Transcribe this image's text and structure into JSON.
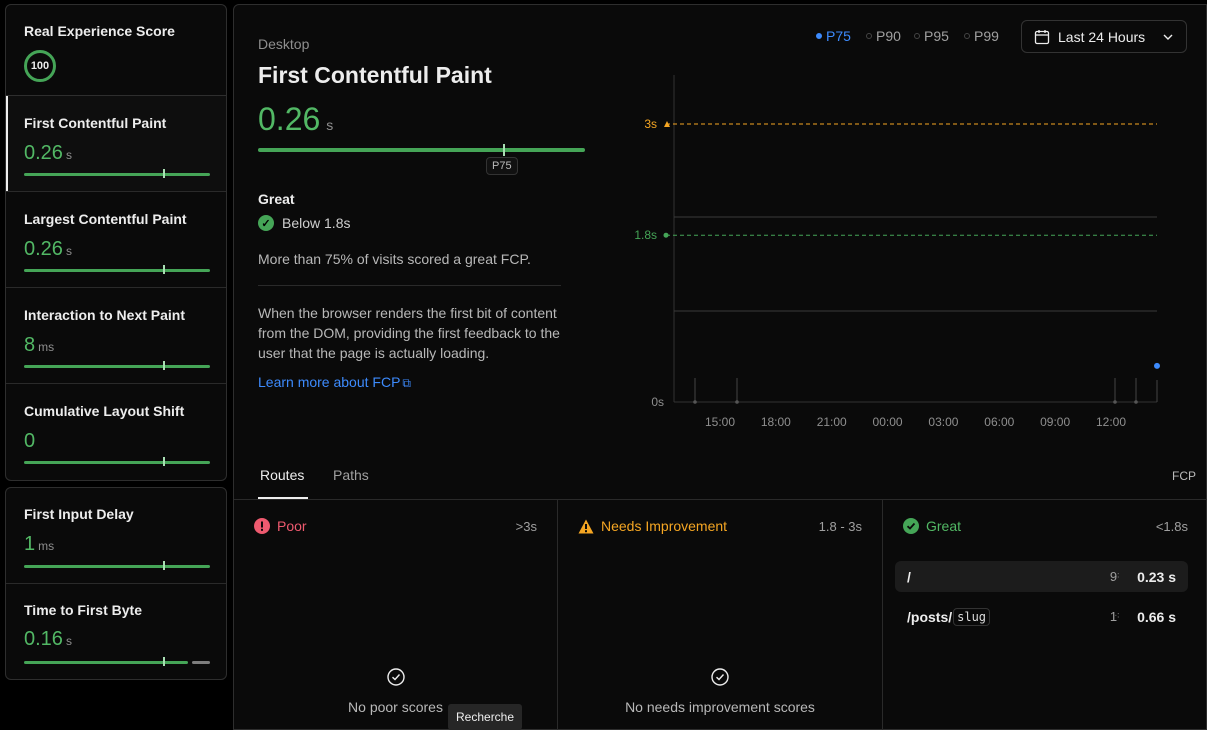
{
  "sidebar": {
    "score": {
      "title": "Real Experience Score",
      "value": "100"
    },
    "metrics": [
      {
        "name": "First Contentful Paint",
        "value": "0.26",
        "unit": "s"
      },
      {
        "name": "Largest Contentful Paint",
        "value": "0.26",
        "unit": "s"
      },
      {
        "name": "Interaction to Next Paint",
        "value": "8",
        "unit": "ms"
      },
      {
        "name": "Cumulative Layout Shift",
        "value": "0",
        "unit": ""
      },
      {
        "name": "First Input Delay",
        "value": "1",
        "unit": "ms"
      },
      {
        "name": "Time to First Byte",
        "value": "0.16",
        "unit": "s"
      }
    ]
  },
  "detail": {
    "device": "Desktop",
    "title": "First Contentful Paint",
    "value": "0.26",
    "unit": "s",
    "marker_label": "P75",
    "rating": "Great",
    "threshold": "Below 1.8s",
    "summary": "More than 75% of visits scored a great FCP.",
    "description": "When the browser renders the first bit of content from the DOM, providing the first feedback to the user that the page is actually loading.",
    "learn_more": "Learn more about FCP"
  },
  "percentiles": [
    "P75",
    "P90",
    "P95",
    "P99"
  ],
  "percentile_selected": "P75",
  "time_range": "Last 24 Hours",
  "chart_data": {
    "type": "line",
    "x_ticks": [
      "15:00",
      "18:00",
      "21:00",
      "00:00",
      "03:00",
      "06:00",
      "09:00",
      "12:00"
    ],
    "y_ticks": [
      "0s",
      "1.8s",
      "3s"
    ],
    "ylim": [
      0,
      3.5
    ],
    "thresholds": [
      {
        "label": "3s",
        "value": 3.0,
        "color": "#f5a623"
      },
      {
        "label": "1.8s",
        "value": 1.8,
        "color": "#45a557"
      }
    ],
    "points": [
      {
        "x": 14.3,
        "y": 0.26,
        "color": "#3d8bfd"
      }
    ]
  },
  "tabs": {
    "routes": "Routes",
    "paths": "Paths",
    "metric": "FCP"
  },
  "columns": {
    "poor": {
      "label": "Poor",
      "range": ">3s",
      "empty": "No poor scores"
    },
    "needs": {
      "label": "Needs Improvement",
      "range": "1.8 - 3s",
      "empty": "No needs improvement scores"
    },
    "great": {
      "label": "Great",
      "range": "<1.8s"
    }
  },
  "routes": [
    {
      "path": "/",
      "slug": "",
      "count": "9",
      "value": "0.23 s"
    },
    {
      "path": "/posts/",
      "slug": "slug",
      "count": "1",
      "value": "0.66 s"
    }
  ],
  "tooltip": "Recherche",
  "colors": {
    "great": "#45a557",
    "needs": "#f5a623",
    "poor": "#ee5a6f",
    "accent": "#3d8bfd"
  }
}
